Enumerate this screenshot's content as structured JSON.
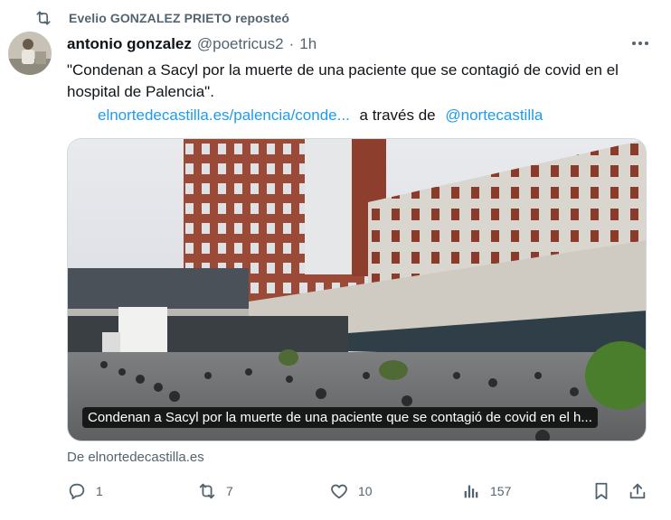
{
  "repost": {
    "text": "Evelio GONZALEZ PRIETO reposteó",
    "icon": "repost-icon"
  },
  "tweet": {
    "author_name": "antonio gonzalez",
    "handle": "@poetricus2",
    "separator": "·",
    "time": "1h",
    "text": "\"Condenan a Sacyl por la muerte de una paciente que se contagió de covid en el hospital de Palencia\".",
    "link_text": "elnortedecastilla.es/palencia/conde...",
    "via_text": "a través de",
    "via_handle": "@nortecastilla"
  },
  "card": {
    "caption": "Condenan a Sacyl por la muerte de una paciente que se contagió de covid en el h...",
    "source": "De elnortedecastilla.es"
  },
  "actions": {
    "replies": "1",
    "reposts": "7",
    "likes": "10",
    "views": "157"
  },
  "colors": {
    "accent": "#1d9bf0",
    "secondary_text": "#536471",
    "primary_text": "#0f1419"
  }
}
